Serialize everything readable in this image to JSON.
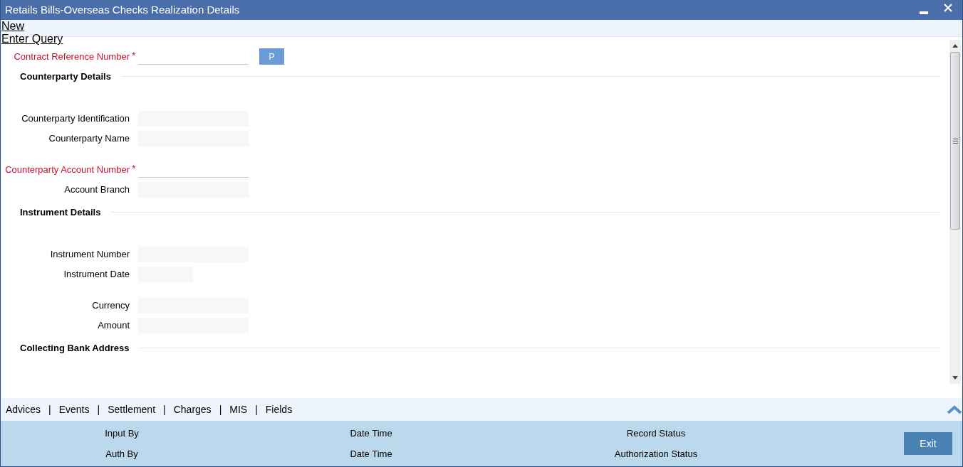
{
  "window": {
    "title": "Retails Bills-Overseas Checks Realization Details"
  },
  "menu": [
    {
      "label": "New"
    },
    {
      "label": "Enter Query"
    }
  ],
  "top_fields": [
    {
      "label": "Contract Reference Number",
      "required": true,
      "required_mark": "*",
      "kind": "text",
      "lookup_button": "P"
    }
  ],
  "sections": [
    {
      "title": "Counterparty Details",
      "groups": [
        [
          {
            "label": "Counterparty Identification",
            "required": false,
            "kind": "text"
          },
          {
            "label": "Counterparty Name",
            "required": false,
            "kind": "text"
          }
        ],
        [
          {
            "label": "Counterparty Account Number",
            "required": true,
            "required_mark": "*",
            "kind": "text"
          },
          {
            "label": "Account Branch",
            "required": false,
            "kind": "text"
          }
        ]
      ]
    },
    {
      "title": "Instrument Details",
      "groups": [
        [
          {
            "label": "Instrument Number",
            "required": false,
            "kind": "text"
          },
          {
            "label": "Instrument Date",
            "required": false,
            "kind": "date"
          }
        ],
        [
          {
            "label": "Currency",
            "required": false,
            "kind": "text"
          },
          {
            "label": "Amount",
            "required": false,
            "kind": "text"
          }
        ]
      ]
    },
    {
      "title": "Collecting Bank Address"
    }
  ],
  "tabs": [
    {
      "label": "Advices"
    },
    {
      "separator": "|",
      "label": "Events"
    },
    {
      "separator": "|",
      "label": "Settlement"
    },
    {
      "separator": "|",
      "label": "Charges"
    },
    {
      "separator": "|",
      "label": "MIS"
    },
    {
      "separator": "|",
      "label": "Fields"
    }
  ],
  "footer": {
    "rows": [
      [
        "Input By",
        "Date Time",
        "Record Status"
      ],
      [
        "Auth By",
        "Date Time",
        "Authorization Status"
      ]
    ],
    "exit_button": "Exit"
  }
}
